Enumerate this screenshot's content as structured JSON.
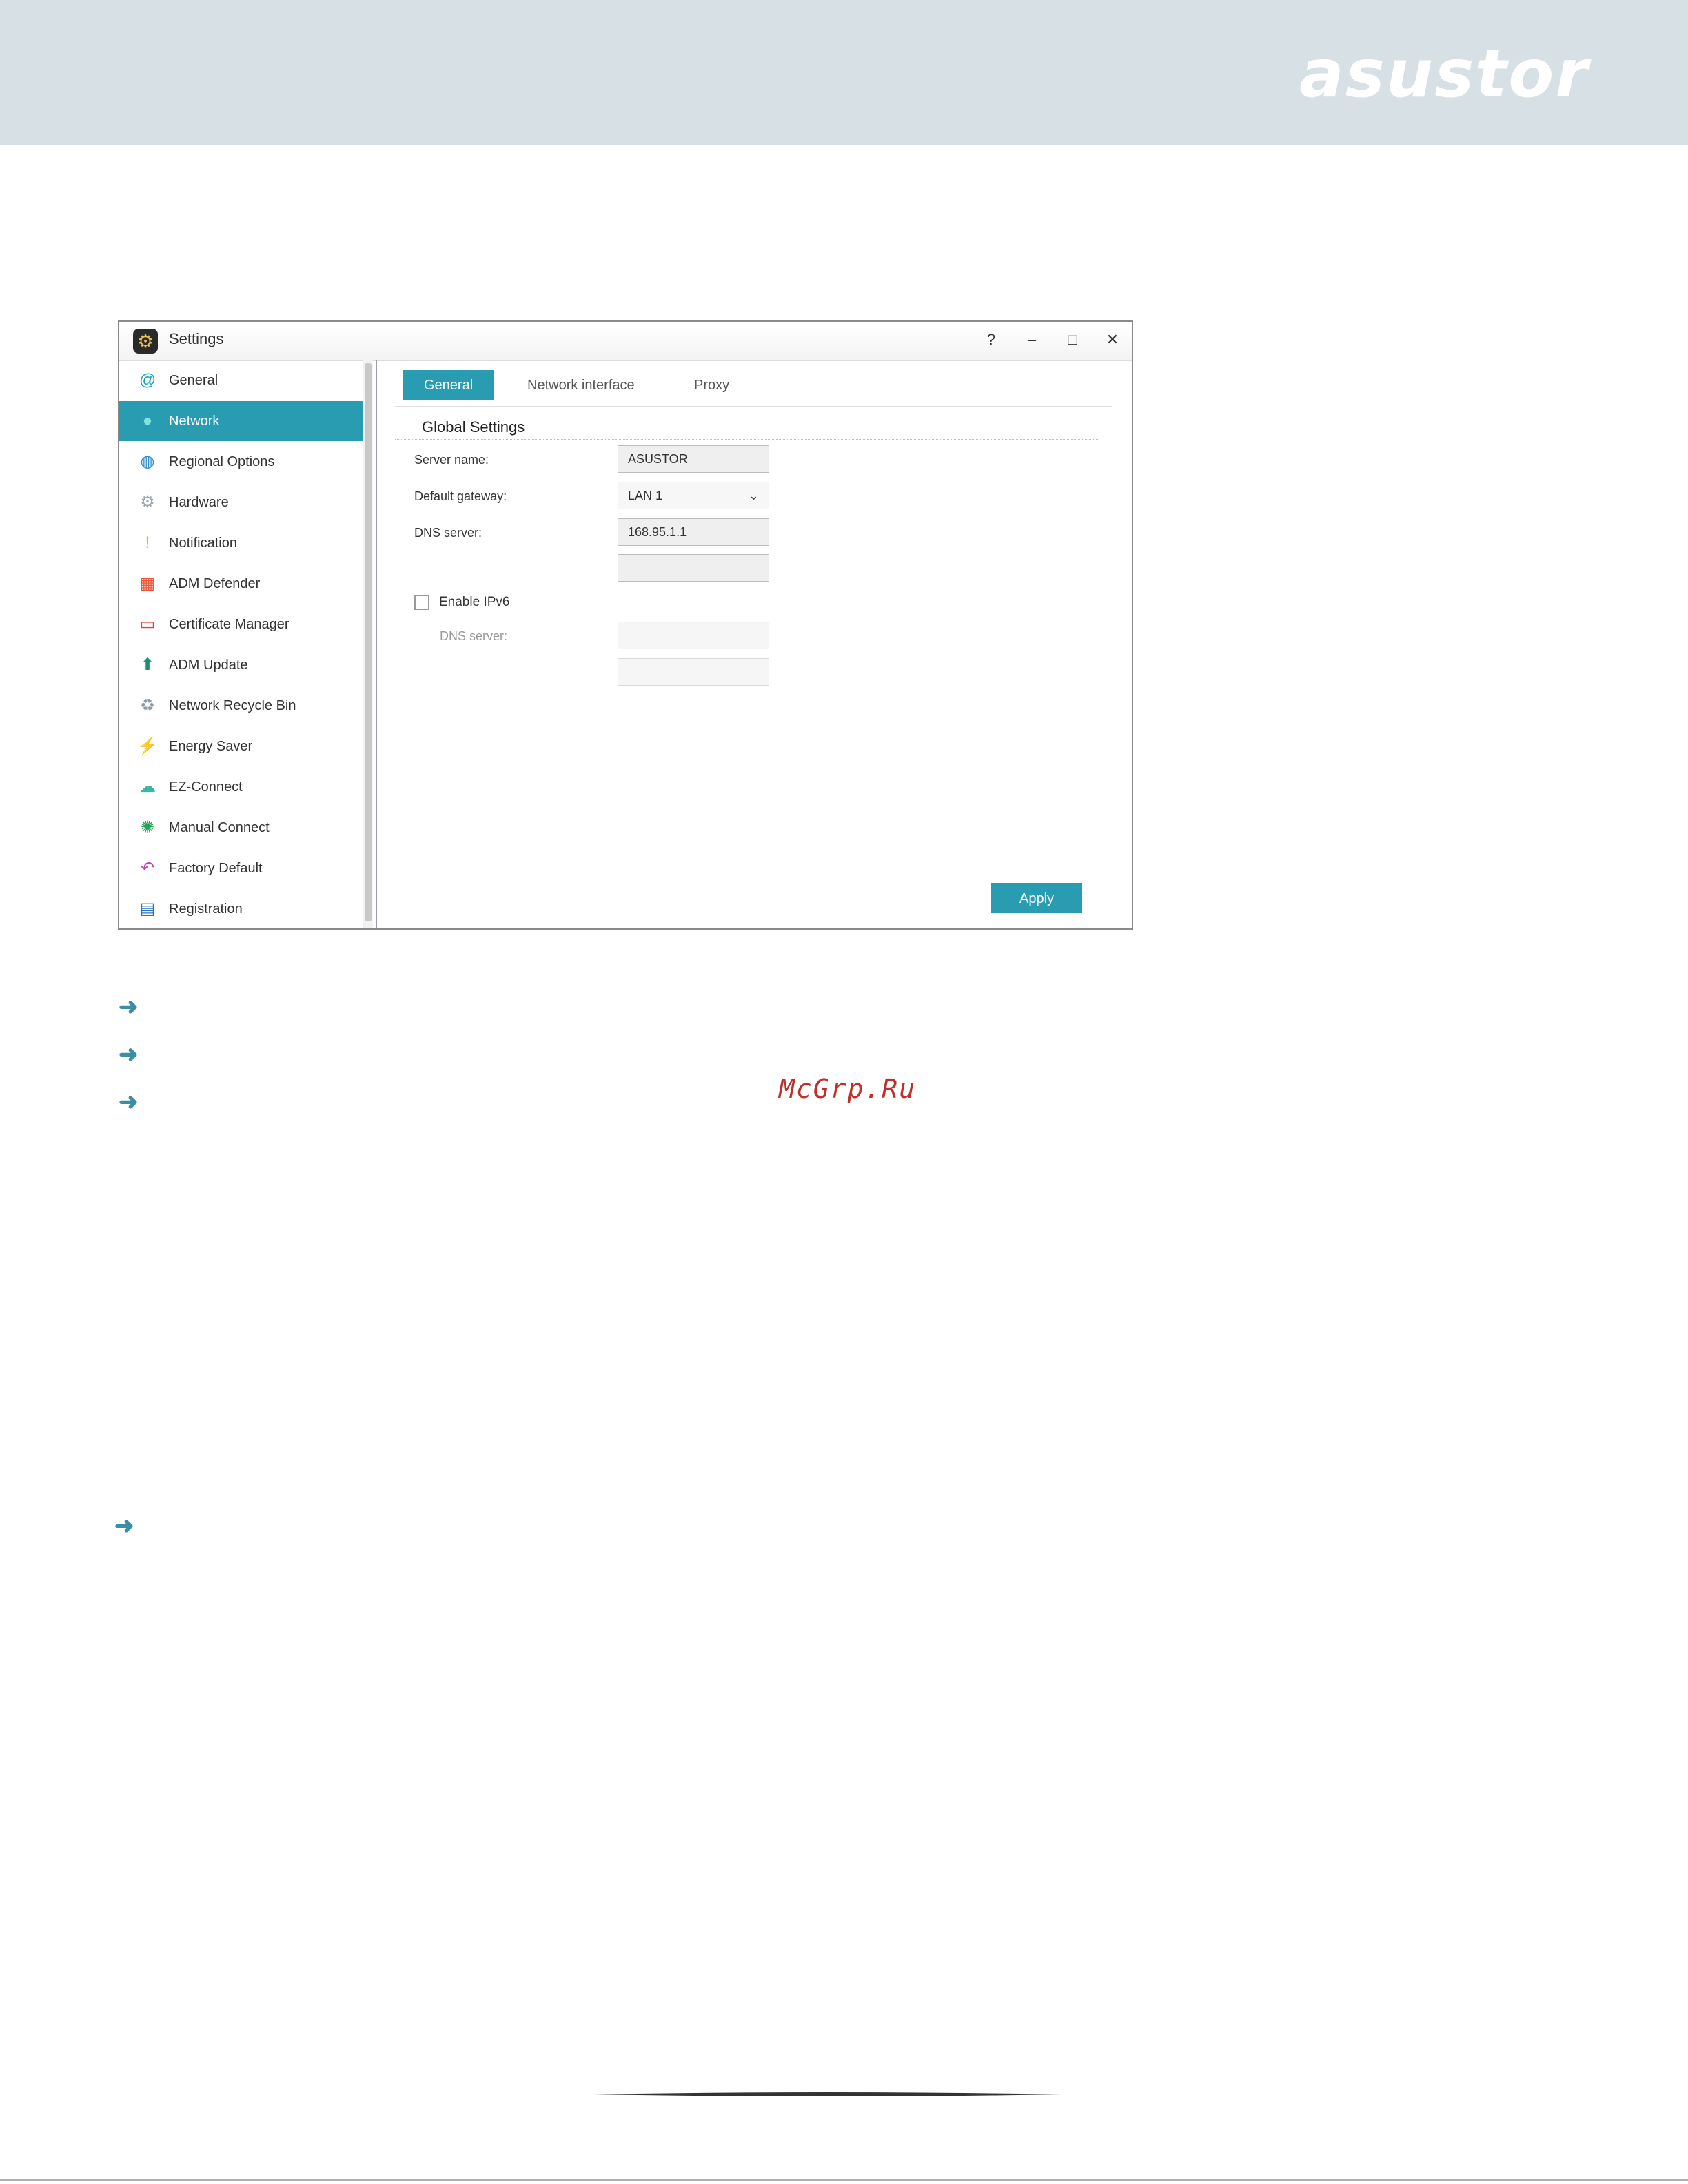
{
  "header": {
    "brand": "asustor",
    "background_color": "#d6e0e5"
  },
  "window": {
    "title": "Settings",
    "app_icon": "settings-gear-icon",
    "controls": [
      "?",
      "–",
      "□",
      "✕"
    ]
  },
  "sidebar": {
    "accent_color": "#2a9cb2",
    "items": [
      {
        "label": "General",
        "icon": "general-icon",
        "icon_glyph": "@",
        "icon_color": "#1aa3b8"
      },
      {
        "label": "Network",
        "icon": "network-icon",
        "icon_glyph": "●",
        "icon_color": "#5fd0c9",
        "active": true
      },
      {
        "label": "Regional Options",
        "icon": "globe-icon",
        "icon_glyph": "◍",
        "icon_color": "#2f8fc7"
      },
      {
        "label": "Hardware",
        "icon": "hardware-icon",
        "icon_glyph": "⚙",
        "icon_color": "#9aa6b2"
      },
      {
        "label": "Notification",
        "icon": "notification-icon",
        "icon_glyph": "!",
        "icon_color": "#f0a91c"
      },
      {
        "label": "ADM Defender",
        "icon": "firewall-icon",
        "icon_glyph": "▦",
        "icon_color": "#e8573c"
      },
      {
        "label": "Certificate Manager",
        "icon": "certificate-icon",
        "icon_glyph": "▭",
        "icon_color": "#e2463a"
      },
      {
        "label": "ADM Update",
        "icon": "update-icon",
        "icon_glyph": "⬆",
        "icon_color": "#1b8f75"
      },
      {
        "label": "Network Recycle Bin",
        "icon": "recycle-bin-icon",
        "icon_glyph": "♻",
        "icon_color": "#8a9ba6"
      },
      {
        "label": "Energy Saver",
        "icon": "energy-icon",
        "icon_glyph": "⚡",
        "icon_color": "#37b24d"
      },
      {
        "label": "EZ-Connect",
        "icon": "cloud-icon",
        "icon_glyph": "☁",
        "icon_color": "#3bb5a6"
      },
      {
        "label": "Manual Connect",
        "icon": "connect-icon",
        "icon_glyph": "✺",
        "icon_color": "#22a35a"
      },
      {
        "label": "Factory Default",
        "icon": "reset-icon",
        "icon_glyph": "↶",
        "icon_color": "#c03fb8"
      },
      {
        "label": "Registration",
        "icon": "registration-icon",
        "icon_glyph": "▤",
        "icon_color": "#2472c8"
      }
    ]
  },
  "tabs": [
    {
      "label": "General",
      "active": true
    },
    {
      "label": "Network interface"
    },
    {
      "label": "Proxy"
    }
  ],
  "form": {
    "section_title": "Global Settings",
    "server_name_label": "Server name:",
    "server_name_value": "ASUSTOR",
    "gateway_label": "Default gateway:",
    "gateway_value": "LAN 1",
    "dns_label": "DNS server:",
    "dns_primary": "168.95.1.1",
    "dns_secondary": "",
    "ipv6_label": "Enable IPv6",
    "ipv6_enabled": false,
    "ipv6_dns_label": "DNS server:",
    "ipv6_dns_primary": "",
    "ipv6_dns_secondary": ""
  },
  "apply_label": "Apply",
  "watermark": "McGrp.Ru"
}
